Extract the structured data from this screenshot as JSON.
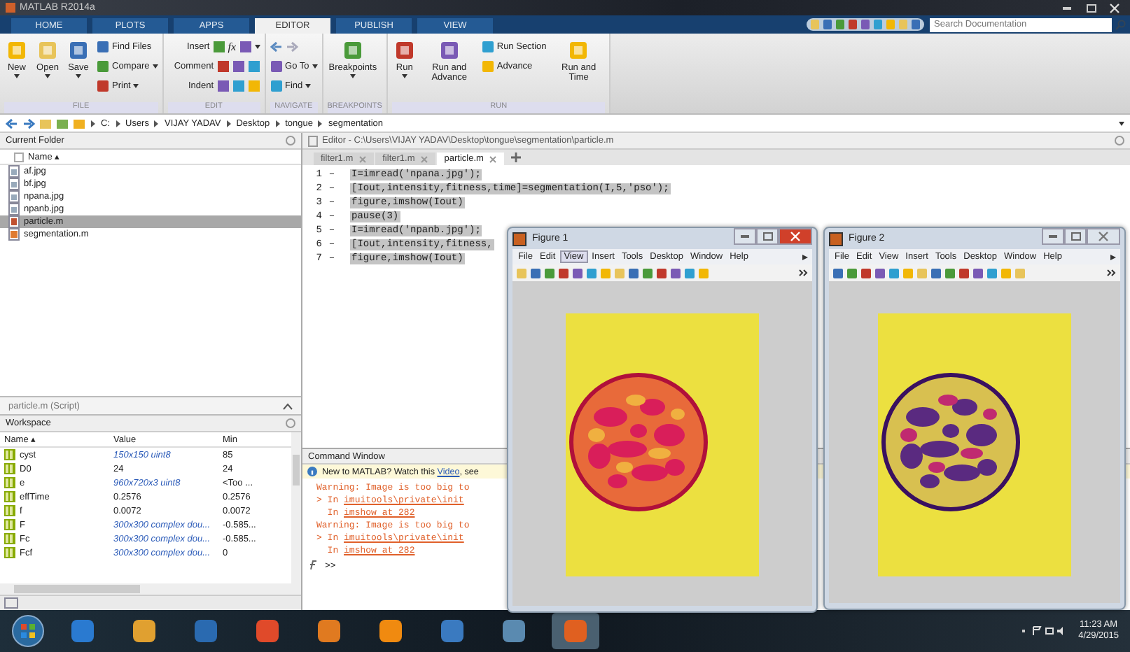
{
  "window": {
    "title": "MATLAB R2014a"
  },
  "tabs": [
    {
      "label": "HOME",
      "selected": false
    },
    {
      "label": "PLOTS",
      "selected": false
    },
    {
      "label": "APPS",
      "selected": false
    },
    {
      "label": "EDITOR",
      "selected": true
    },
    {
      "label": "PUBLISH",
      "selected": false
    },
    {
      "label": "VIEW",
      "selected": false
    }
  ],
  "search": {
    "placeholder": "Search Documentation"
  },
  "toolstrip": [
    {
      "label": "FILE",
      "columns": [
        [
          {
            "label": "New",
            "kind": "large",
            "dropdown": true
          }
        ],
        [
          {
            "label": "Open",
            "kind": "large",
            "dropdown": true
          }
        ],
        [
          {
            "label": "Save",
            "kind": "large",
            "dropdown": true
          }
        ],
        [
          {
            "label": "Find Files",
            "kind": "small",
            "dropdown": false
          },
          {
            "label": "Compare",
            "kind": "small",
            "dropdown": true
          },
          {
            "label": "Print",
            "kind": "small",
            "dropdown": true
          }
        ]
      ]
    },
    {
      "label": "EDIT",
      "columns": [
        [
          {
            "label": "Insert",
            "kind": "tool",
            "symbol": "fx",
            "dropdown": true
          },
          {
            "label": "Comment",
            "kind": "tool",
            "dropdown": false
          },
          {
            "label": "Indent",
            "kind": "tool",
            "dropdown": false
          }
        ]
      ]
    },
    {
      "label": "NAVIGATE",
      "columns": [
        [
          {
            "kind": "icons"
          },
          {
            "label": "Go To",
            "kind": "small",
            "dropdown": true
          },
          {
            "label": "Find",
            "kind": "small",
            "dropdown": true
          }
        ]
      ]
    },
    {
      "label": "BREAKPOINTS",
      "columns": [
        [
          {
            "label": "Breakpoints",
            "kind": "large",
            "dropdown": true
          }
        ]
      ]
    },
    {
      "label": "RUN",
      "columns": [
        [
          {
            "label": "Run",
            "kind": "large",
            "dropdown": true
          }
        ],
        [
          {
            "label": "Run and Advance",
            "kind": "large",
            "dropdown": false
          }
        ],
        [
          {
            "label": "Run Section",
            "kind": "small",
            "dropdown": false
          },
          {
            "label": "Advance",
            "kind": "small",
            "dropdown": false
          }
        ],
        [
          {
            "label": "Run and Time",
            "kind": "large",
            "dropdown": false
          }
        ]
      ]
    }
  ],
  "address": [
    "C:",
    "Users",
    "VIJAY YADAV",
    "Desktop",
    "tongue",
    "segmentation"
  ],
  "current_folder": {
    "title": "Current Folder",
    "column": "Name ▴",
    "files": [
      {
        "name": "af.jpg",
        "kind": "image",
        "selected": false
      },
      {
        "name": "bf.jpg",
        "kind": "image",
        "selected": false
      },
      {
        "name": "npana.jpg",
        "kind": "image",
        "selected": false
      },
      {
        "name": "npanb.jpg",
        "kind": "image",
        "selected": false
      },
      {
        "name": "particle.m",
        "kind": "script",
        "selected": true
      },
      {
        "name": "segmentation.m",
        "kind": "function",
        "selected": false
      }
    ],
    "details": "particle.m (Script)"
  },
  "workspace": {
    "title": "Workspace",
    "columns": [
      "Name ▴",
      "Value",
      "Min"
    ],
    "rows": [
      {
        "name": "cyst",
        "value": "150x150 uint8",
        "min": "85",
        "kind": "array"
      },
      {
        "name": "D0",
        "value": "24",
        "min": "24",
        "kind": "scalar"
      },
      {
        "name": "e",
        "value": "960x720x3 uint8",
        "min": "<Too ...",
        "kind": "array"
      },
      {
        "name": "effTime",
        "value": "0.2576",
        "min": "0.2576",
        "kind": "scalar"
      },
      {
        "name": "f",
        "value": "0.0072",
        "min": "0.0072",
        "kind": "scalar"
      },
      {
        "name": "F",
        "value": "300x300 complex dou...",
        "min": "-0.585...",
        "kind": "array"
      },
      {
        "name": "Fc",
        "value": "300x300 complex dou...",
        "min": "-0.585...",
        "kind": "array"
      },
      {
        "name": "Fcf",
        "value": "300x300 complex dou...",
        "min": "0",
        "kind": "array"
      }
    ]
  },
  "editor": {
    "title": "Editor - C:\\Users\\VIJAY YADAV\\Desktop\\tongue\\segmentation\\particle.m",
    "tabs": [
      {
        "label": "filter1.m",
        "selected": false
      },
      {
        "label": "filter1.m",
        "selected": false
      },
      {
        "label": "particle.m",
        "selected": true
      }
    ],
    "lines": [
      {
        "number": "1",
        "mark": "–",
        "code": "I=imread('npana.jpg');",
        "selected": true
      },
      {
        "number": "2",
        "mark": "–",
        "code": "[Iout,intensity,fitness,time]=segmentation(I,5,'pso');",
        "selected": true
      },
      {
        "number": "3",
        "mark": "–",
        "code": "figure,imshow(Iout)",
        "selected": true
      },
      {
        "number": "4",
        "mark": "–",
        "code": "pause(3)",
        "selected": true
      },
      {
        "number": "5",
        "mark": "–",
        "code": "I=imread('npanb.jpg');",
        "selected": true
      },
      {
        "number": "6",
        "mark": "–",
        "code": "[Iout,intensity,fitness,",
        "selected": true
      },
      {
        "number": "7",
        "mark": "–",
        "code": "figure,imshow(Iout)",
        "selected": true
      }
    ]
  },
  "command_window": {
    "title": "Command Window",
    "info": {
      "text": "New to MATLAB? Watch this ",
      "link": "Video",
      "rest": ", see"
    },
    "lines": [
      {
        "kind": "warning",
        "text": "Warning: Image is too big to"
      },
      {
        "kind": "trace",
        "prefix": "> In ",
        "link": "imuitools\\private\\init"
      },
      {
        "kind": "trace",
        "prefix": "  In ",
        "link": "imshow at 282"
      },
      {
        "kind": "warning",
        "text": "Warning: Image is too big to"
      },
      {
        "kind": "trace",
        "prefix": "> In ",
        "link": "imuitools\\private\\init"
      },
      {
        "kind": "trace",
        "prefix": "  In ",
        "link": "imshow at 282"
      }
    ],
    "prompt": ">>"
  },
  "figures": [
    {
      "title": "Figure 1",
      "active": true,
      "menus": [
        {
          "label": "File",
          "selected": false
        },
        {
          "label": "Edit",
          "selected": false
        },
        {
          "label": "View",
          "selected": true
        },
        {
          "label": "Insert",
          "selected": false
        },
        {
          "label": "Tools",
          "selected": false
        },
        {
          "label": "Desktop",
          "selected": false
        },
        {
          "label": "Window",
          "selected": false
        },
        {
          "label": "Help",
          "selected": false
        }
      ],
      "image": {
        "kind": "warm"
      }
    },
    {
      "title": "Figure 2",
      "active": false,
      "menus": [
        {
          "label": "File",
          "selected": false
        },
        {
          "label": "Edit",
          "selected": false
        },
        {
          "label": "View",
          "selected": false
        },
        {
          "label": "Insert",
          "selected": false
        },
        {
          "label": "Tools",
          "selected": false
        },
        {
          "label": "Desktop",
          "selected": false
        },
        {
          "label": "Window",
          "selected": false
        },
        {
          "label": "Help",
          "selected": false
        }
      ],
      "image": {
        "kind": "cool"
      }
    }
  ],
  "clock": {
    "time": "11:23 AM",
    "date": "4/29/2015"
  }
}
